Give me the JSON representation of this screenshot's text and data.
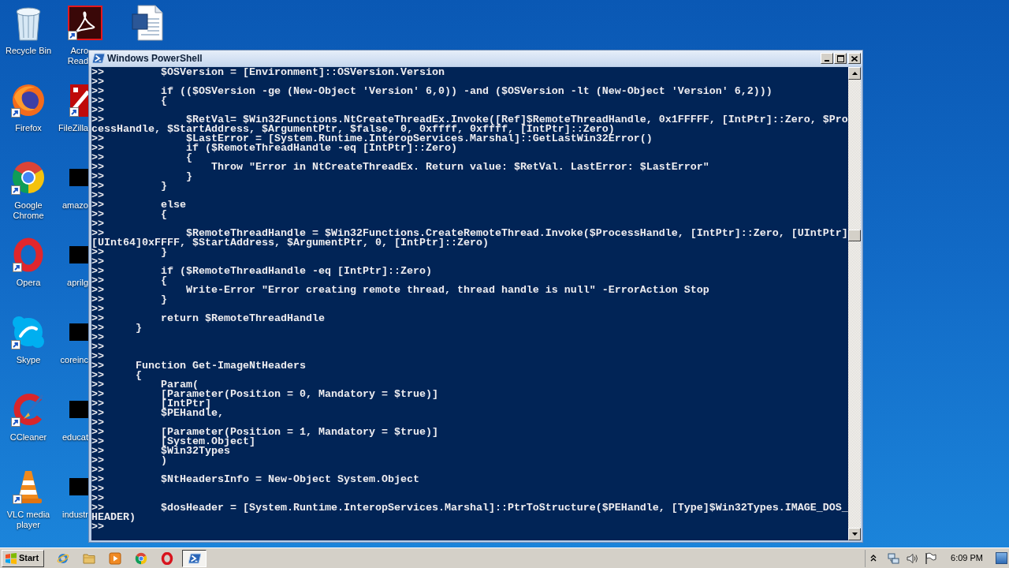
{
  "desktop": {
    "icon_columns": [
      {
        "icons": [
          {
            "kind": "recyclebin",
            "label": "Recycle Bin",
            "shortcut": false
          },
          {
            "kind": "firefox",
            "label": "Firefox",
            "shortcut": true
          },
          {
            "kind": "chrome",
            "label": "Google Chrome",
            "shortcut": true
          },
          {
            "kind": "opera",
            "label": "Opera",
            "shortcut": true
          },
          {
            "kind": "skype",
            "label": "Skype",
            "shortcut": true
          },
          {
            "kind": "ccleaner",
            "label": "CCleaner",
            "shortcut": true
          },
          {
            "kind": "vlc",
            "label": "VLC media player",
            "shortcut": true
          }
        ]
      },
      {
        "icons": [
          {
            "kind": "acrobat",
            "label": "Acro Read",
            "shortcut": true
          },
          {
            "kind": "filezilla",
            "label": "FileZilla",
            "shortcut": true
          },
          {
            "kind": "thumbnail",
            "label": "amazo",
            "shortcut": false
          },
          {
            "kind": "thumbnail",
            "label": "aprilg",
            "shortcut": false
          },
          {
            "kind": "thumbnail",
            "label": "coreinc",
            "shortcut": false
          },
          {
            "kind": "thumbnail",
            "label": "educat",
            "shortcut": false
          },
          {
            "kind": "thumbnail",
            "label": "industr",
            "shortcut": false
          }
        ]
      },
      {
        "icons": [
          {
            "kind": "word",
            "shortcut": false
          }
        ]
      }
    ]
  },
  "window": {
    "title": "Windows PowerShell",
    "lines": [
      ">>         $OSVersion = [Environment]::OSVersion.Version",
      ">>",
      ">>         if (($OSVersion -ge (New-Object 'Version' 6,0)) -and ($OSVersion -lt (New-Object 'Version' 6,2)))",
      ">>         {",
      ">>",
      ">>             $RetVal= $Win32Functions.NtCreateThreadEx.Invoke([Ref]$RemoteThreadHandle, 0x1FFFFF, [IntPtr]::Zero, $Pro",
      "cessHandle, $StartAddress, $ArgumentPtr, $false, 0, 0xffff, 0xffff, [IntPtr]::Zero)",
      ">>             $LastError = [System.Runtime.InteropServices.Marshal]::GetLastWin32Error()",
      ">>             if ($RemoteThreadHandle -eq [IntPtr]::Zero)",
      ">>             {",
      ">>                 Throw \"Error in NtCreateThreadEx. Return value: $RetVal. LastError: $LastError\"",
      ">>             }",
      ">>         }",
      ">>",
      ">>         else",
      ">>         {",
      ">>",
      ">>             $RemoteThreadHandle = $Win32Functions.CreateRemoteThread.Invoke($ProcessHandle, [IntPtr]::Zero, [UIntPtr]",
      "[UInt64]0xFFFF, $StartAddress, $ArgumentPtr, 0, [IntPtr]::Zero)",
      ">>         }",
      ">>",
      ">>         if ($RemoteThreadHandle -eq [IntPtr]::Zero)",
      ">>         {",
      ">>             Write-Error \"Error creating remote thread, thread handle is null\" -ErrorAction Stop",
      ">>         }",
      ">>",
      ">>         return $RemoteThreadHandle",
      ">>     }",
      ">>",
      ">>",
      ">>",
      ">>     Function Get-ImageNtHeaders",
      ">>     {",
      ">>         Param(",
      ">>         [Parameter(Position = 0, Mandatory = $true)]",
      ">>         [IntPtr]",
      ">>         $PEHandle,",
      ">>",
      ">>         [Parameter(Position = 1, Mandatory = $true)]",
      ">>         [System.Object]",
      ">>         $Win32Types",
      ">>         )",
      ">>",
      ">>         $NtHeadersInfo = New-Object System.Object",
      ">>",
      ">>",
      ">>         $dosHeader = [System.Runtime.InteropServices.Marshal]::PtrToStructure($PEHandle, [Type]$Win32Types.IMAGE_DOS_",
      "HEADER)",
      ">>"
    ]
  },
  "taskbar": {
    "start": "Start",
    "tasks": [
      {
        "kind": "console",
        "selected": true
      }
    ],
    "clock": "6:09 PM"
  }
}
